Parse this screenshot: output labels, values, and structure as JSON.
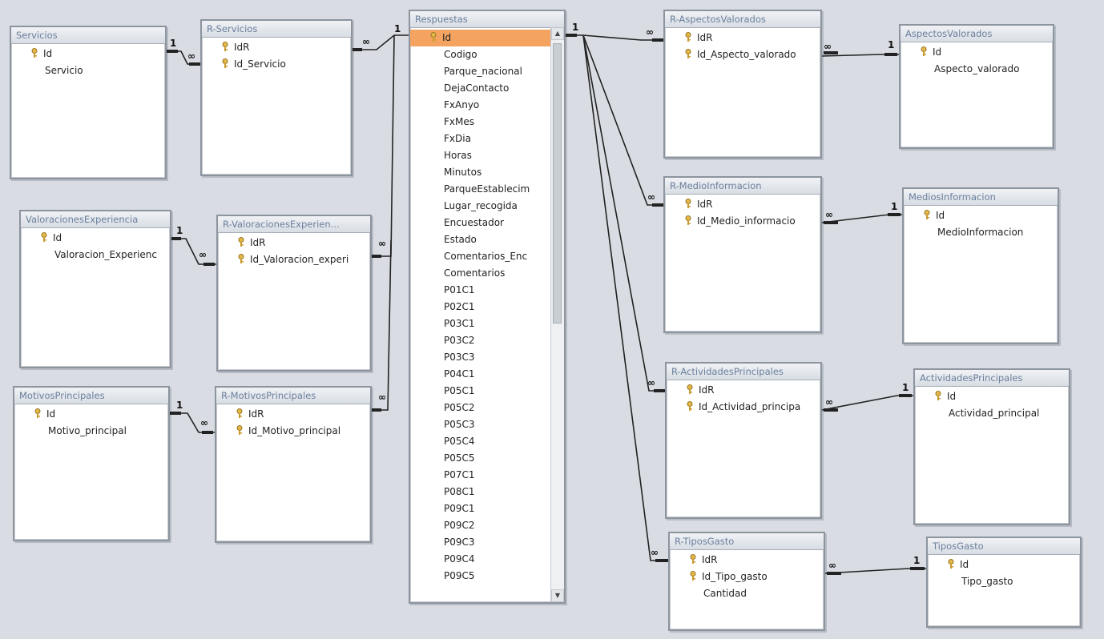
{
  "tables": {
    "servicios": {
      "title": "Servicios",
      "fields": [
        "Id",
        "Servicio"
      ]
    },
    "r_servicios": {
      "title": "R-Servicios",
      "fields": [
        "IdR",
        "Id_Servicio"
      ]
    },
    "respuestas": {
      "title": "Respuestas",
      "fields": [
        "Id",
        "Codigo",
        "Parque_nacional",
        "DejaContacto",
        "FxAnyo",
        "FxMes",
        "FxDia",
        "Horas",
        "Minutos",
        "ParqueEstablecim",
        "Lugar_recogida",
        "Encuestador",
        "Estado",
        "Comentarios_Enc",
        "Comentarios",
        "P01C1",
        "P02C1",
        "P03C1",
        "P03C2",
        "P03C3",
        "P04C1",
        "P05C1",
        "P05C2",
        "P05C3",
        "P05C4",
        "P05C5",
        "P07C1",
        "P08C1",
        "P09C1",
        "P09C2",
        "P09C3",
        "P09C4",
        "P09C5"
      ]
    },
    "valoraciones_experiencia": {
      "title": "ValoracionesExperiencia",
      "fields": [
        "Id",
        "Valoracion_Experienc"
      ]
    },
    "r_valoraciones_experiencia": {
      "title": "R-ValoracionesExperien...",
      "fields": [
        "IdR",
        "Id_Valoracion_experi"
      ]
    },
    "motivos_principales": {
      "title": "MotivosPrincipales",
      "fields": [
        "Id",
        "Motivo_principal"
      ]
    },
    "r_motivos_principales": {
      "title": "R-MotivosPrincipales",
      "fields": [
        "IdR",
        "Id_Motivo_principal"
      ]
    },
    "r_aspectos_valorados": {
      "title": "R-AspectosValorados",
      "fields": [
        "IdR",
        "Id_Aspecto_valorado"
      ]
    },
    "aspectos_valorados": {
      "title": "AspectosValorados",
      "fields": [
        "Id",
        "Aspecto_valorado"
      ]
    },
    "r_medio_informacion": {
      "title": "R-MedioInformacion",
      "fields": [
        "IdR",
        "Id_Medio_informacio"
      ]
    },
    "medios_informacion": {
      "title": "MediosInformacion",
      "fields": [
        "Id",
        "MedioInformacion"
      ]
    },
    "r_actividades_principales": {
      "title": "R-ActividadesPrincipales",
      "fields": [
        "IdR",
        "Id_Actividad_principa"
      ]
    },
    "actividades_principales": {
      "title": "ActividadesPrincipales",
      "fields": [
        "Id",
        "Actividad_principal"
      ]
    },
    "r_tipos_gasto": {
      "title": "R-TiposGasto",
      "fields": [
        "IdR",
        "Id_Tipo_gasto",
        "Cantidad"
      ]
    },
    "tipos_gasto": {
      "title": "TiposGasto",
      "fields": [
        "Id",
        "Tipo_gasto"
      ]
    }
  },
  "relationship_labels": {
    "one": "1",
    "many": "∞"
  },
  "colors": {
    "line": "#222222",
    "selected": "#f4a460",
    "title_text": "#6a7f9c"
  },
  "icons": {
    "primary_key": "key-icon",
    "scroll_up": "up-arrow-icon",
    "scroll_down": "down-arrow-icon"
  }
}
